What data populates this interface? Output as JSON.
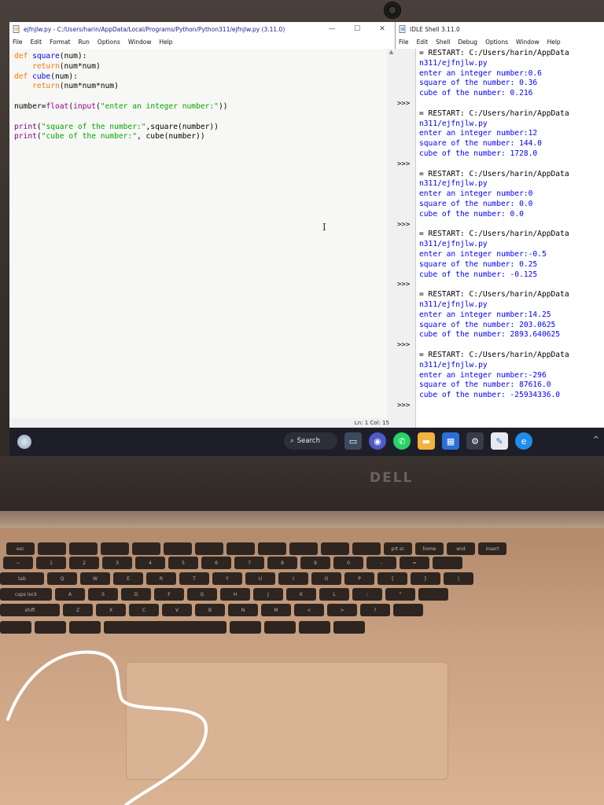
{
  "editor": {
    "title": "ejfnjlw.py - C:/Users/harin/AppData/Local/Programs/Python/Python311/ejfnjlw.py (3.11.0)",
    "menu": [
      "File",
      "Edit",
      "Format",
      "Run",
      "Options",
      "Window",
      "Help"
    ],
    "window_buttons": [
      "—",
      "☐",
      "✕"
    ],
    "code_lines": [
      [
        [
          "kw",
          "def "
        ],
        [
          "def",
          "square"
        ],
        [
          "",
          "(num):"
        ]
      ],
      [
        [
          "",
          "    "
        ],
        [
          "kw",
          "return"
        ],
        [
          "",
          "(num*num)"
        ]
      ],
      [
        [
          "kw",
          "def "
        ],
        [
          "def",
          "cube"
        ],
        [
          "",
          "(num):"
        ]
      ],
      [
        [
          "",
          "    "
        ],
        [
          "kw",
          "return"
        ],
        [
          "",
          "(num*num*num)"
        ]
      ],
      [
        [
          "",
          ""
        ]
      ],
      [
        [
          "",
          "number="
        ],
        [
          "bi",
          "float"
        ],
        [
          "",
          "("
        ],
        [
          "bi",
          "input"
        ],
        [
          "",
          "("
        ],
        [
          "str",
          "\"enter an integer number:\""
        ],
        [
          "",
          "))"
        ]
      ],
      [
        [
          "",
          ""
        ]
      ],
      [
        [
          "bi",
          "print"
        ],
        [
          "",
          "("
        ],
        [
          "str",
          "\"square of the number:\""
        ],
        [
          "",
          ",square(number))"
        ]
      ],
      [
        [
          "bi",
          "print"
        ],
        [
          "",
          "("
        ],
        [
          "str",
          "\"cube of the number:\""
        ],
        [
          "",
          ", cube(number))"
        ]
      ]
    ],
    "status": "Ln: 1   Col: 15"
  },
  "shell": {
    "title": "IDLE Shell 3.11.0",
    "menu": [
      "File",
      "Edit",
      "Shell",
      "Debug",
      "Options",
      "Window",
      "Help"
    ],
    "prompt": ">>>",
    "runs": [
      {
        "restart": "= RESTART: C:/Users/harin/AppData",
        "path": "n311/ejfnjlw.py",
        "outputs": [
          "enter an integer number:0.6",
          "square of the number: 0.36",
          "cube of the number: 0.216"
        ]
      },
      {
        "restart": "= RESTART: C:/Users/harin/AppData",
        "path": "n311/ejfnjlw.py",
        "outputs": [
          "enter an integer number:12",
          "square of the number: 144.0",
          "cube of the number: 1728.0"
        ]
      },
      {
        "restart": "= RESTART: C:/Users/harin/AppData",
        "path": "n311/ejfnjlw.py",
        "outputs": [
          "enter an integer number:0",
          "square of the number: 0.0",
          "cube of the number: 0.0"
        ]
      },
      {
        "restart": "= RESTART: C:/Users/harin/AppData",
        "path": "n311/ejfnjlw.py",
        "outputs": [
          "enter an integer number:-0.5",
          "square of the number: 0.25",
          "cube of the number: -0.125"
        ]
      },
      {
        "restart": "= RESTART: C:/Users/harin/AppData",
        "path": "n311/ejfnjlw.py",
        "outputs": [
          "enter an integer number:14.25",
          "square of the number: 203.0625",
          "cube of the number: 2893.640625"
        ]
      },
      {
        "restart": "= RESTART: C:/Users/harin/AppData",
        "path": "n311/ejfnjlw.py",
        "outputs": [
          "enter an integer number:-296",
          "square of the number: 87616.0",
          "cube of the number: -25934336.0"
        ]
      }
    ]
  },
  "taskbar": {
    "search_label": "Search",
    "icons": [
      "start-icon",
      "search-icon",
      "file-explorer-icon",
      "teams-icon",
      "whatsapp-icon",
      "folder-icon",
      "store-icon",
      "settings-icon",
      "idle-icon",
      "edge-icon"
    ]
  },
  "laptop": {
    "brand": "DELL"
  },
  "keyboard": {
    "row0": [
      "esc",
      "",
      "",
      "",
      "",
      "",
      "",
      "",
      "",
      "",
      "",
      "",
      "prt sc",
      "home",
      "end",
      "insert"
    ],
    "row1": [
      "~",
      "1",
      "2",
      "3",
      "4",
      "5",
      "6",
      "7",
      "8",
      "9",
      "0",
      "-",
      "=",
      ""
    ],
    "row2": [
      "tab",
      "Q",
      "W",
      "E",
      "R",
      "T",
      "Y",
      "U",
      "I",
      "O",
      "P",
      "{",
      "}",
      "|"
    ],
    "row3": [
      "caps lock",
      "A",
      "S",
      "D",
      "F",
      "G",
      "H",
      "J",
      "K",
      "L",
      ":",
      "\"",
      ""
    ],
    "row4": [
      "shift",
      "Z",
      "X",
      "C",
      "V",
      "B",
      "N",
      "M",
      "<",
      ">",
      "?",
      ""
    ],
    "row5": [
      "",
      "",
      "",
      "",
      "",
      "",
      "",
      ""
    ]
  },
  "colors": {
    "keyword": "#ff7700",
    "def": "#0000ff",
    "string": "#00aa00",
    "builtin": "#900090",
    "output": "#0000ff",
    "taskbar": "#1e1e28"
  }
}
